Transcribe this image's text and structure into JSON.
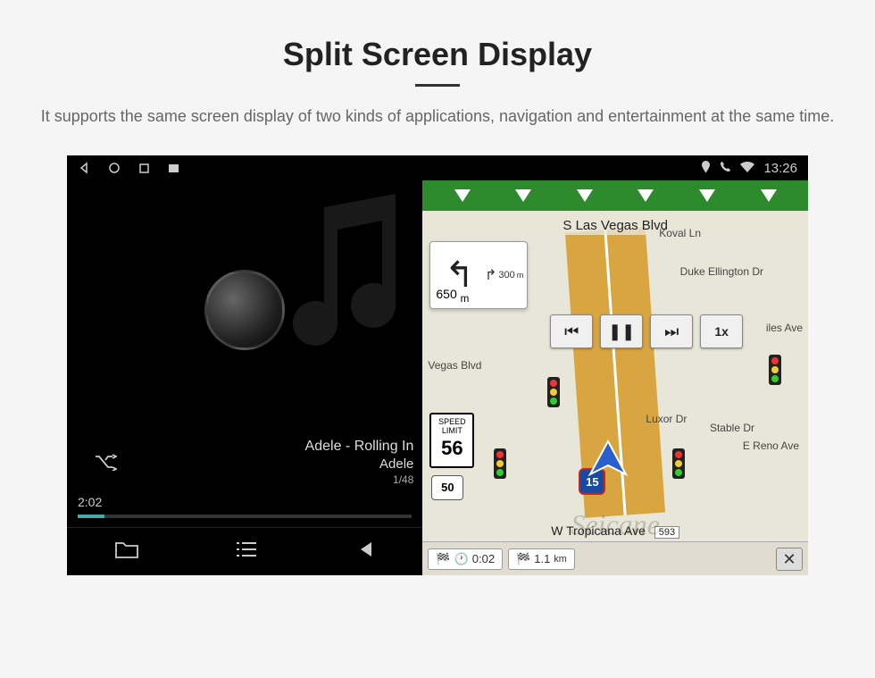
{
  "page": {
    "title": "Split Screen Display",
    "subtitle": "It supports the same screen display of two kinds of applications, navigation and entertainment at the same time."
  },
  "statusbar": {
    "time": "13:26"
  },
  "music": {
    "track_title": "Adele - Rolling In",
    "track_artist": "Adele",
    "track_count": "1/48",
    "elapsed": "2:02"
  },
  "nav": {
    "street_top": "S Las Vegas Blvd",
    "street_bottom": "W Tropicana Ave",
    "turn_next_dist": "300",
    "turn_next_unit": "m",
    "turn_dist": "650",
    "turn_unit": "m",
    "speed_label": "SPEED LIMIT",
    "speed_value": "56",
    "route_badge": "50",
    "interstate": "15",
    "playback_speed": "1x",
    "bottom_time": "0:02",
    "bottom_dist": "1.1",
    "bottom_dist_unit": "km",
    "street_pill": "593",
    "poi_vegas": "Vegas Blvd",
    "poi_duke": "Duke Ellington Dr",
    "poi_koval": "Koval Ln",
    "poi_luxor": "Luxor Dr",
    "poi_stable": "Stable Dr",
    "poi_reno": "E Reno Ave",
    "poi_miles": "iles Ave",
    "watermark": "Seicane"
  }
}
